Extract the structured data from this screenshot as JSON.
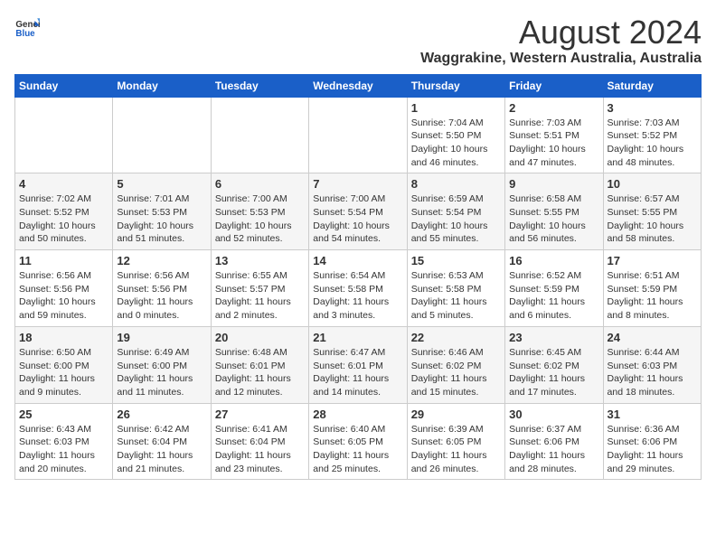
{
  "header": {
    "logo_line1": "General",
    "logo_line2": "Blue",
    "title": "August 2024",
    "subtitle": "Waggrakine, Western Australia, Australia"
  },
  "weekdays": [
    "Sunday",
    "Monday",
    "Tuesday",
    "Wednesday",
    "Thursday",
    "Friday",
    "Saturday"
  ],
  "weeks": [
    [
      {
        "day": "",
        "info": ""
      },
      {
        "day": "",
        "info": ""
      },
      {
        "day": "",
        "info": ""
      },
      {
        "day": "",
        "info": ""
      },
      {
        "day": "1",
        "info": "Sunrise: 7:04 AM\nSunset: 5:50 PM\nDaylight: 10 hours\nand 46 minutes."
      },
      {
        "day": "2",
        "info": "Sunrise: 7:03 AM\nSunset: 5:51 PM\nDaylight: 10 hours\nand 47 minutes."
      },
      {
        "day": "3",
        "info": "Sunrise: 7:03 AM\nSunset: 5:52 PM\nDaylight: 10 hours\nand 48 minutes."
      }
    ],
    [
      {
        "day": "4",
        "info": "Sunrise: 7:02 AM\nSunset: 5:52 PM\nDaylight: 10 hours\nand 50 minutes."
      },
      {
        "day": "5",
        "info": "Sunrise: 7:01 AM\nSunset: 5:53 PM\nDaylight: 10 hours\nand 51 minutes."
      },
      {
        "day": "6",
        "info": "Sunrise: 7:00 AM\nSunset: 5:53 PM\nDaylight: 10 hours\nand 52 minutes."
      },
      {
        "day": "7",
        "info": "Sunrise: 7:00 AM\nSunset: 5:54 PM\nDaylight: 10 hours\nand 54 minutes."
      },
      {
        "day": "8",
        "info": "Sunrise: 6:59 AM\nSunset: 5:54 PM\nDaylight: 10 hours\nand 55 minutes."
      },
      {
        "day": "9",
        "info": "Sunrise: 6:58 AM\nSunset: 5:55 PM\nDaylight: 10 hours\nand 56 minutes."
      },
      {
        "day": "10",
        "info": "Sunrise: 6:57 AM\nSunset: 5:55 PM\nDaylight: 10 hours\nand 58 minutes."
      }
    ],
    [
      {
        "day": "11",
        "info": "Sunrise: 6:56 AM\nSunset: 5:56 PM\nDaylight: 10 hours\nand 59 minutes."
      },
      {
        "day": "12",
        "info": "Sunrise: 6:56 AM\nSunset: 5:56 PM\nDaylight: 11 hours\nand 0 minutes."
      },
      {
        "day": "13",
        "info": "Sunrise: 6:55 AM\nSunset: 5:57 PM\nDaylight: 11 hours\nand 2 minutes."
      },
      {
        "day": "14",
        "info": "Sunrise: 6:54 AM\nSunset: 5:58 PM\nDaylight: 11 hours\nand 3 minutes."
      },
      {
        "day": "15",
        "info": "Sunrise: 6:53 AM\nSunset: 5:58 PM\nDaylight: 11 hours\nand 5 minutes."
      },
      {
        "day": "16",
        "info": "Sunrise: 6:52 AM\nSunset: 5:59 PM\nDaylight: 11 hours\nand 6 minutes."
      },
      {
        "day": "17",
        "info": "Sunrise: 6:51 AM\nSunset: 5:59 PM\nDaylight: 11 hours\nand 8 minutes."
      }
    ],
    [
      {
        "day": "18",
        "info": "Sunrise: 6:50 AM\nSunset: 6:00 PM\nDaylight: 11 hours\nand 9 minutes."
      },
      {
        "day": "19",
        "info": "Sunrise: 6:49 AM\nSunset: 6:00 PM\nDaylight: 11 hours\nand 11 minutes."
      },
      {
        "day": "20",
        "info": "Sunrise: 6:48 AM\nSunset: 6:01 PM\nDaylight: 11 hours\nand 12 minutes."
      },
      {
        "day": "21",
        "info": "Sunrise: 6:47 AM\nSunset: 6:01 PM\nDaylight: 11 hours\nand 14 minutes."
      },
      {
        "day": "22",
        "info": "Sunrise: 6:46 AM\nSunset: 6:02 PM\nDaylight: 11 hours\nand 15 minutes."
      },
      {
        "day": "23",
        "info": "Sunrise: 6:45 AM\nSunset: 6:02 PM\nDaylight: 11 hours\nand 17 minutes."
      },
      {
        "day": "24",
        "info": "Sunrise: 6:44 AM\nSunset: 6:03 PM\nDaylight: 11 hours\nand 18 minutes."
      }
    ],
    [
      {
        "day": "25",
        "info": "Sunrise: 6:43 AM\nSunset: 6:03 PM\nDaylight: 11 hours\nand 20 minutes."
      },
      {
        "day": "26",
        "info": "Sunrise: 6:42 AM\nSunset: 6:04 PM\nDaylight: 11 hours\nand 21 minutes."
      },
      {
        "day": "27",
        "info": "Sunrise: 6:41 AM\nSunset: 6:04 PM\nDaylight: 11 hours\nand 23 minutes."
      },
      {
        "day": "28",
        "info": "Sunrise: 6:40 AM\nSunset: 6:05 PM\nDaylight: 11 hours\nand 25 minutes."
      },
      {
        "day": "29",
        "info": "Sunrise: 6:39 AM\nSunset: 6:05 PM\nDaylight: 11 hours\nand 26 minutes."
      },
      {
        "day": "30",
        "info": "Sunrise: 6:37 AM\nSunset: 6:06 PM\nDaylight: 11 hours\nand 28 minutes."
      },
      {
        "day": "31",
        "info": "Sunrise: 6:36 AM\nSunset: 6:06 PM\nDaylight: 11 hours\nand 29 minutes."
      }
    ]
  ]
}
